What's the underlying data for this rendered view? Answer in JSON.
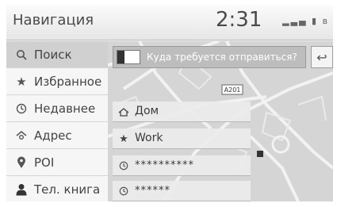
{
  "header": {
    "title": "Навигация",
    "clock": "2:31",
    "status_icons": [
      "signal-icon",
      "battery-icon",
      "bluetooth-icon"
    ]
  },
  "sidebar": {
    "items": [
      {
        "label": "Поиск",
        "icon": "search-icon",
        "active": true
      },
      {
        "label": "Избранное",
        "icon": "star-icon"
      },
      {
        "label": "Недавнее",
        "icon": "clock-icon"
      },
      {
        "label": "Адрес",
        "icon": "address-icon"
      },
      {
        "label": "POI",
        "icon": "location-pin-icon"
      },
      {
        "label": "Тел. книга",
        "icon": "contact-icon"
      }
    ]
  },
  "search": {
    "placeholder": "Куда требуется отправиться?"
  },
  "map": {
    "road_label": "A201"
  },
  "favorites": [
    {
      "label": "Дом",
      "icon": "home-icon"
    },
    {
      "label": "Work",
      "icon": "star-icon"
    },
    {
      "label": "**********",
      "icon": "clock-icon"
    },
    {
      "label": "******",
      "icon": "clock-icon"
    }
  ],
  "colors": {
    "header_bg": "#eeeeee",
    "sidebar_active": "#d0d0d0",
    "searchbar_bg": "#bdbdbd",
    "map_bg": "#d7d7d7",
    "text": "#444444"
  }
}
